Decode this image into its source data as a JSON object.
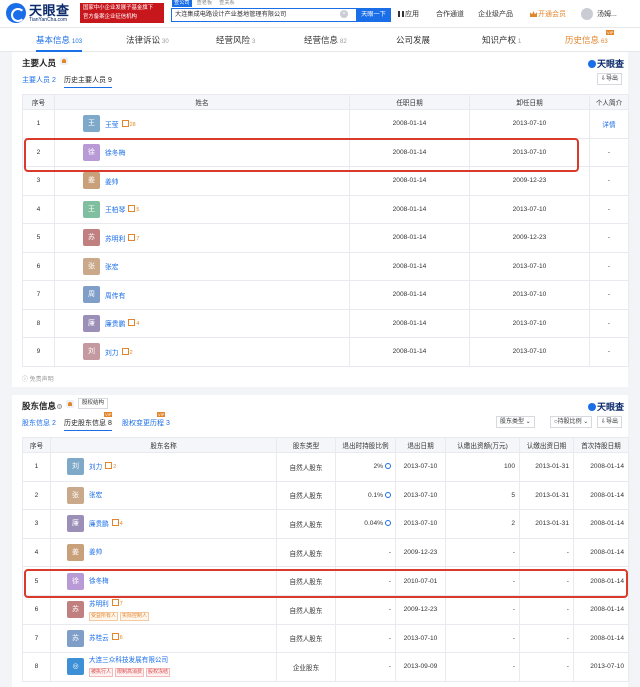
{
  "header": {
    "logo_cn": "天眼查",
    "logo_en": "TianYanCha.com",
    "banner_line1": "国家中小企业发展子基金旗下",
    "banner_line2": "官方备案企业征信机构",
    "search_tabs": [
      "查公司",
      "查老板",
      "查关系"
    ],
    "search_value": "大连集成电路设计产业基地管理有限公司",
    "search_clear": "×",
    "search_button": "天眼一下",
    "nav": [
      "应用",
      "合作通道",
      "企业级产品",
      "开通会员",
      "汤姆..."
    ],
    "vip_color": "#e2862b"
  },
  "tabs": [
    {
      "label": "基本信息",
      "count": "103"
    },
    {
      "label": "法律诉讼",
      "count": "30"
    },
    {
      "label": "经营风险",
      "count": "3"
    },
    {
      "label": "经营信息",
      "count": "82"
    },
    {
      "label": "公司发展",
      "count": ""
    },
    {
      "label": "知识产权",
      "count": "1"
    },
    {
      "label": "历史信息",
      "count": "63"
    }
  ],
  "tab_badge": "VIP",
  "personnel": {
    "title": "主要人员",
    "brand": "天眼查",
    "subtabs": [
      "主要人员 2",
      "历史主要人员 9"
    ],
    "export": "导出",
    "columns": [
      "序号",
      "姓名",
      "任职日期",
      "卸任日期",
      "个人简介"
    ],
    "rows": [
      {
        "no": "1",
        "avatar": "王",
        "color": "#7fa9c8",
        "name": "王莹",
        "rel": "28",
        "start": "2008-01-14",
        "end": "2013-07-10",
        "bio": "详情"
      },
      {
        "no": "2",
        "avatar": "徐",
        "color": "#b79ad6",
        "name": "徐冬梅",
        "rel": "",
        "start": "2008-01-14",
        "end": "2013-07-10",
        "bio": "-"
      },
      {
        "no": "3",
        "avatar": "姜",
        "color": "#c8a07a",
        "name": "姜帅",
        "rel": "",
        "start": "2008-01-14",
        "end": "2009-12-23",
        "bio": "-"
      },
      {
        "no": "4",
        "avatar": "王",
        "color": "#7fbf9f",
        "name": "王柏琴",
        "rel": "5",
        "start": "2008-01-14",
        "end": "2013-07-10",
        "bio": "-"
      },
      {
        "no": "5",
        "avatar": "苏",
        "color": "#c08080",
        "name": "苏明利",
        "rel": "7",
        "start": "2008-01-14",
        "end": "2009-12-23",
        "bio": "-"
      },
      {
        "no": "6",
        "avatar": "张",
        "color": "#c9a98a",
        "name": "张宏",
        "rel": "",
        "start": "2008-01-14",
        "end": "2013-07-10",
        "bio": "-"
      },
      {
        "no": "7",
        "avatar": "周",
        "color": "#7f9ec8",
        "name": "周传有",
        "rel": "",
        "start": "2008-01-14",
        "end": "2013-07-10",
        "bio": "-"
      },
      {
        "no": "8",
        "avatar": "廉",
        "color": "#9b8fb8",
        "name": "廉贵鹏",
        "rel": "4",
        "start": "2008-01-14",
        "end": "2013-07-10",
        "bio": "-"
      },
      {
        "no": "9",
        "avatar": "刘",
        "color": "#c49aa0",
        "name": "刘力",
        "rel": "2",
        "start": "2008-01-14",
        "end": "2013-07-10",
        "bio": "-"
      }
    ],
    "footnote": "免责声明"
  },
  "shareholders": {
    "title": "股东信息",
    "badge": "股权结构",
    "brand": "天眼查",
    "subtabs": [
      "股东信息 2",
      "历史股东信息 8",
      "股权变更历程 3"
    ],
    "filters": [
      "股东类型",
      "持股比例",
      "导出"
    ],
    "columns": [
      "序号",
      "股东名称",
      "股东类型",
      "退出时持股比例",
      "退出日期",
      "认缴出资额(万元)",
      "认缴出资日期",
      "首次持股日期"
    ],
    "rows": [
      {
        "no": "1",
        "avatar": "刘",
        "color": "#7fa9c8",
        "name": "刘力",
        "rel": "2",
        "tags": [],
        "type": "自然人股东",
        "ratio": "2%",
        "clock": true,
        "exit": "2013-07-10",
        "amount": "100",
        "paydate": "2013-01-31",
        "first": "2008-01-14"
      },
      {
        "no": "2",
        "avatar": "张",
        "color": "#c9a98a",
        "name": "张宏",
        "rel": "",
        "tags": [],
        "type": "自然人股东",
        "ratio": "0.1%",
        "clock": true,
        "exit": "2013-07-10",
        "amount": "5",
        "paydate": "2013-01-31",
        "first": "2008-01-14"
      },
      {
        "no": "3",
        "avatar": "廉",
        "color": "#9b8fb8",
        "name": "廉贵鹏",
        "rel": "4",
        "tags": [],
        "type": "自然人股东",
        "ratio": "0.04%",
        "clock": true,
        "exit": "2013-07-10",
        "amount": "2",
        "paydate": "2013-01-31",
        "first": "2008-01-14"
      },
      {
        "no": "4",
        "avatar": "姜",
        "color": "#c8a07a",
        "name": "姜帅",
        "rel": "",
        "tags": [],
        "type": "自然人股东",
        "ratio": "-",
        "clock": false,
        "exit": "2009-12-23",
        "amount": "-",
        "paydate": "-",
        "first": "2008-01-14"
      },
      {
        "no": "5",
        "avatar": "徐",
        "color": "#b79ad6",
        "name": "徐冬梅",
        "rel": "",
        "tags": [],
        "type": "自然人股东",
        "ratio": "-",
        "clock": false,
        "exit": "2010-07-01",
        "amount": "-",
        "paydate": "-",
        "first": "2008-01-14"
      },
      {
        "no": "6",
        "avatar": "苏",
        "color": "#c08080",
        "name": "苏明利",
        "rel": "7",
        "tags": [
          "受益所有人",
          "实际控制人"
        ],
        "type": "自然人股东",
        "ratio": "-",
        "clock": false,
        "exit": "2009-12-23",
        "amount": "-",
        "paydate": "-",
        "first": "2008-01-14"
      },
      {
        "no": "7",
        "avatar": "苏",
        "color": "#7f9ec8",
        "name": "苏桂云",
        "rel": "6",
        "tags": [],
        "type": "自然人股东",
        "ratio": "-",
        "clock": false,
        "exit": "2013-07-10",
        "amount": "-",
        "paydate": "-",
        "first": "2008-01-14"
      },
      {
        "no": "8",
        "avatar": "◎",
        "color": "#3d8fd6",
        "name": "大连三众科技发展有限公司",
        "rel": "",
        "tags": [
          "被执行人",
          "限制高消费",
          "股权冻结"
        ],
        "type": "企业股东",
        "ratio": "-",
        "clock": false,
        "exit": "2013-09-09",
        "amount": "-",
        "paydate": "-",
        "first": "2013-07-10"
      }
    ]
  },
  "highlight_color": "#d93a2b"
}
